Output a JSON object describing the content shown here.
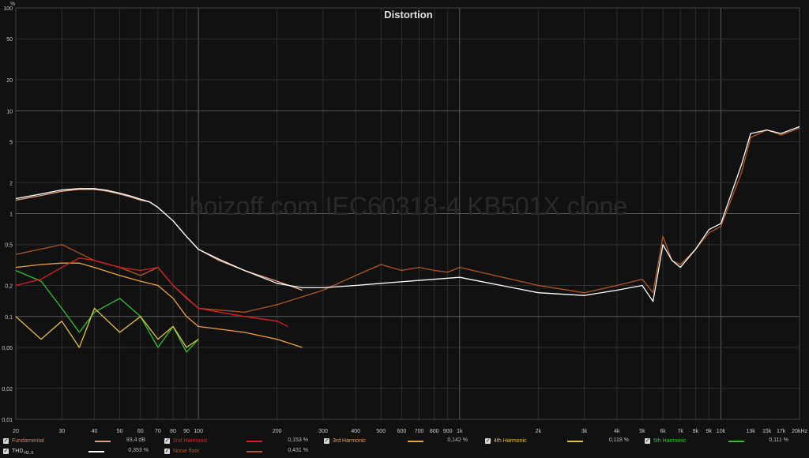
{
  "chart_data": {
    "type": "line",
    "title": "Distortion",
    "watermark": "boizoff.com IEC60318-4 KB501X clone",
    "y_unit": "%",
    "x_scale": "log",
    "y_scale": "log",
    "xlim": [
      20,
      20000
    ],
    "ylim": [
      0.01,
      100
    ],
    "grid": true,
    "legend_placement": "bottom",
    "x_ticks": [
      "20",
      "30",
      "40",
      "50",
      "60",
      "70",
      "80",
      "90",
      "100",
      "200",
      "300",
      "400",
      "500",
      "600",
      "700",
      "800",
      "900",
      "1k",
      "2k",
      "3k",
      "4k",
      "5k",
      "6k",
      "7k",
      "8k",
      "9k",
      "10k",
      "15k",
      "20kHz"
    ],
    "x_tick_values": [
      20,
      30,
      40,
      50,
      60,
      70,
      80,
      90,
      100,
      200,
      300,
      400,
      500,
      600,
      700,
      800,
      900,
      1000,
      2000,
      3000,
      4000,
      5000,
      6000,
      7000,
      8000,
      9000,
      10000,
      15000,
      20000
    ],
    "x_minor_ticks": [
      "13k",
      "17k"
    ],
    "x_minor_tick_values": [
      13000,
      17000
    ],
    "y_ticks": [
      "100",
      "50",
      "20",
      "10",
      "5",
      "2",
      "1",
      "0,5",
      "0,2",
      "0,1",
      "0,05",
      "0,02",
      "0,01"
    ],
    "y_tick_values": [
      100,
      50,
      20,
      10,
      5,
      2,
      1,
      0.5,
      0.2,
      0.1,
      0.05,
      0.02,
      0.01
    ],
    "series": [
      {
        "name": "Fundamental",
        "legend_value": "93,4 dB",
        "color": "#e8a07a",
        "x": [
          20,
          25,
          30,
          35,
          40,
          45,
          50,
          55,
          60,
          65,
          70,
          80,
          90,
          100,
          120,
          150,
          200,
          250
        ],
        "y": [
          1.35,
          1.5,
          1.65,
          1.72,
          1.72,
          1.65,
          1.55,
          1.45,
          1.35,
          1.3,
          1.15,
          0.85,
          0.6,
          0.45,
          0.35,
          0.28,
          0.22,
          0.18
        ]
      },
      {
        "name": "THD",
        "legend_value": "0,353 %",
        "color": "#ffffff",
        "x": [
          20,
          25,
          30,
          35,
          40,
          45,
          50,
          55,
          60,
          65,
          70,
          80,
          90,
          100,
          120,
          150,
          200,
          250,
          300,
          400,
          500,
          1000,
          2000,
          3000,
          4000,
          5000,
          5500,
          6000,
          6500,
          7000,
          8000,
          9000,
          10000,
          12000,
          13000,
          15000,
          17000,
          20000
        ],
        "y": [
          1.4,
          1.55,
          1.7,
          1.75,
          1.75,
          1.68,
          1.58,
          1.48,
          1.38,
          1.3,
          1.15,
          0.85,
          0.6,
          0.45,
          0.36,
          0.28,
          0.21,
          0.19,
          0.19,
          0.2,
          0.21,
          0.24,
          0.17,
          0.16,
          0.18,
          0.2,
          0.14,
          0.5,
          0.35,
          0.3,
          0.45,
          0.7,
          0.8,
          3.0,
          6.0,
          6.5,
          6.0,
          7.0
        ]
      },
      {
        "name": "2nd Harmonic",
        "legend_value": "0,153 %",
        "color": "#d92020",
        "x": [
          20,
          25,
          30,
          35,
          40,
          50,
          60,
          70,
          80,
          90,
          100,
          150,
          200,
          220
        ],
        "y": [
          0.2,
          0.23,
          0.3,
          0.37,
          0.35,
          0.3,
          0.28,
          0.3,
          0.2,
          0.15,
          0.12,
          0.1,
          0.09,
          0.08
        ]
      },
      {
        "name": "3rd Harmonic",
        "legend_value": "0,142 %",
        "color": "#f0a040",
        "x": [
          20,
          25,
          30,
          35,
          40,
          50,
          60,
          70,
          80,
          90,
          100,
          150,
          200,
          250
        ],
        "y": [
          0.3,
          0.32,
          0.33,
          0.33,
          0.3,
          0.25,
          0.22,
          0.2,
          0.15,
          0.1,
          0.08,
          0.07,
          0.06,
          0.05
        ]
      },
      {
        "name": "4th Harmonic",
        "legend_value": "0,118 %",
        "color": "#e8c040",
        "x": [
          20,
          25,
          30,
          35,
          40,
          50,
          60,
          70,
          80,
          90,
          100
        ],
        "y": [
          0.1,
          0.06,
          0.09,
          0.05,
          0.12,
          0.07,
          0.1,
          0.06,
          0.08,
          0.05,
          0.06
        ]
      },
      {
        "name": "5th Harmonic",
        "legend_value": "0,111 %",
        "color": "#30c030",
        "x": [
          20,
          25,
          30,
          35,
          40,
          50,
          60,
          70,
          80,
          90,
          100
        ],
        "y": [
          0.28,
          0.22,
          0.12,
          0.07,
          0.11,
          0.15,
          0.1,
          0.05,
          0.08,
          0.045,
          0.06
        ]
      },
      {
        "name": "Noise floor",
        "legend_value": "0,431 %",
        "color": "#b05820",
        "x": [
          20,
          30,
          40,
          50,
          60,
          70,
          80,
          100,
          150,
          200,
          300,
          400,
          500,
          600,
          700,
          800,
          900,
          1000,
          2000,
          3000,
          4000,
          5000,
          5500,
          6000,
          6500,
          7000,
          8000,
          9000,
          10000,
          12000,
          13000,
          15000,
          17000,
          20000
        ],
        "y": [
          0.4,
          0.5,
          0.35,
          0.3,
          0.25,
          0.3,
          0.2,
          0.12,
          0.11,
          0.13,
          0.18,
          0.25,
          0.32,
          0.28,
          0.3,
          0.28,
          0.27,
          0.3,
          0.2,
          0.17,
          0.2,
          0.23,
          0.17,
          0.6,
          0.35,
          0.32,
          0.45,
          0.65,
          0.75,
          2.5,
          5.5,
          6.5,
          5.8,
          6.8
        ]
      }
    ]
  },
  "legend": [
    {
      "label": "Fundamental",
      "value": "93,4 dB",
      "color": "#e8a07a",
      "checked": "✓"
    },
    {
      "label": "2nd Harmonic",
      "value": "0,153 %",
      "color": "#d92020",
      "checked": "✓"
    },
    {
      "label": "3rd Harmonic",
      "value": "0,142 %",
      "color": "#f0a040",
      "checked": "✓"
    },
    {
      "label": "4th Harmonic",
      "value": "0,118 %",
      "color": "#e8c040",
      "checked": "✓"
    },
    {
      "label": "5th Harmonic",
      "value": "0,111 %",
      "color": "#30c030",
      "checked": "✓"
    },
    {
      "label": "THD",
      "sub": "H2..5",
      "value": "0,353 %",
      "color": "#ffffff",
      "checked": "✓"
    },
    {
      "label": "Noise floor",
      "value": "0,431 %",
      "color": "#b05820",
      "checked": "✓"
    }
  ]
}
